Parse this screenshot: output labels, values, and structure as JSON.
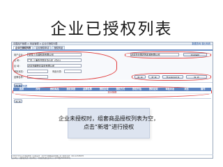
{
  "slide": {
    "title": "企业已授权列表"
  },
  "app": {
    "breadcrumb": "中国用户管理 > 商品管理 > 企业已授权列表",
    "top_right_links": "数据查询 退出系统",
    "tabs": [
      "企业已授权列表",
      "企业授权申请",
      "授权商品"
    ]
  },
  "form": {
    "labels": {
      "enterprise_user": "用户企业：",
      "name": "名    称：",
      "region": "区    域：",
      "approval_status": "审批状态：",
      "category": "商品分类：",
      "brand": "品牌名称："
    },
    "values": {
      "enterprise_user": "*北京上合城科技有限公司",
      "name": "广东-上海市开发区中心区（中心）",
      "region": "北京市朝阳区建设有限公司",
      "company_right": "北京市全国农牧机械有限公司"
    },
    "buttons": {
      "query": "查 询",
      "add": "新 增",
      "reset": "重 置",
      "query_auth": "查询授权",
      "export": "导出用户信息"
    }
  },
  "table": {
    "section_label": "企业授权列表",
    "headers": [
      "选择",
      "序号",
      "授权商品",
      "授权类别",
      "品牌名称",
      "授权区域",
      "授权方式",
      "授权开始",
      "授权结束",
      "审批状态",
      "状态",
      "操作"
    ],
    "empty_message": "暂无数据"
  },
  "callout": {
    "line1": "企业未授权时，组套商品授权列表为空，",
    "line2": "点击“新增”进行授权"
  },
  "footer": {
    "line1": "©2014 华为公司 版权所有 | 技术支持：北京华为网络技术有限公司 | 联系电话：010-12345678",
    "line2": "主办单位：国家商务部 | 承办单位：中国商务部信息中心 | 京ICP备05000000号"
  }
}
